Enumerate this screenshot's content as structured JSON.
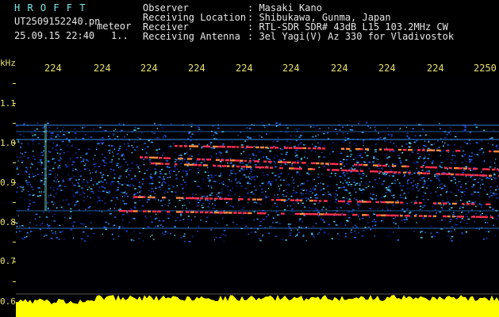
{
  "header": {
    "app_name": "H R O F F T",
    "filename": "UT2509152240.pn",
    "filename_suffix": "meteor",
    "datetime": "25.09.15 22:40",
    "page_marker": "1..",
    "fields": [
      {
        "label": "Observer",
        "value": ": Masaki Kano"
      },
      {
        "label": "Receiving Location",
        "value": ": Shibukawa, Gunma, Japan"
      },
      {
        "label": "Receiver",
        "value": ": RTL-SDR SDR# 43dB L15 103.2MHz CW"
      },
      {
        "label": "Receiving Antenna",
        "value": ": 3el Yagi(V) Az 330 for Vladivostok"
      }
    ]
  },
  "axes": {
    "unit": "kHz",
    "time_ticks": [
      "224",
      "224",
      "224",
      "224",
      "224",
      "224",
      "224",
      "224",
      "224",
      "2250"
    ],
    "freq_ticks": [
      "1.1",
      "1.0",
      "0.9",
      "0.8",
      "0.7",
      "0.6"
    ]
  },
  "colors": {
    "header_label": "#7fe8e8",
    "header_value": "#e6e6e6",
    "axis": "#e8e070",
    "background": "#000000",
    "spectrum_fill": "#ffff00",
    "echo_trace": "#ff3050",
    "noise_band": "#1d46d8"
  }
}
